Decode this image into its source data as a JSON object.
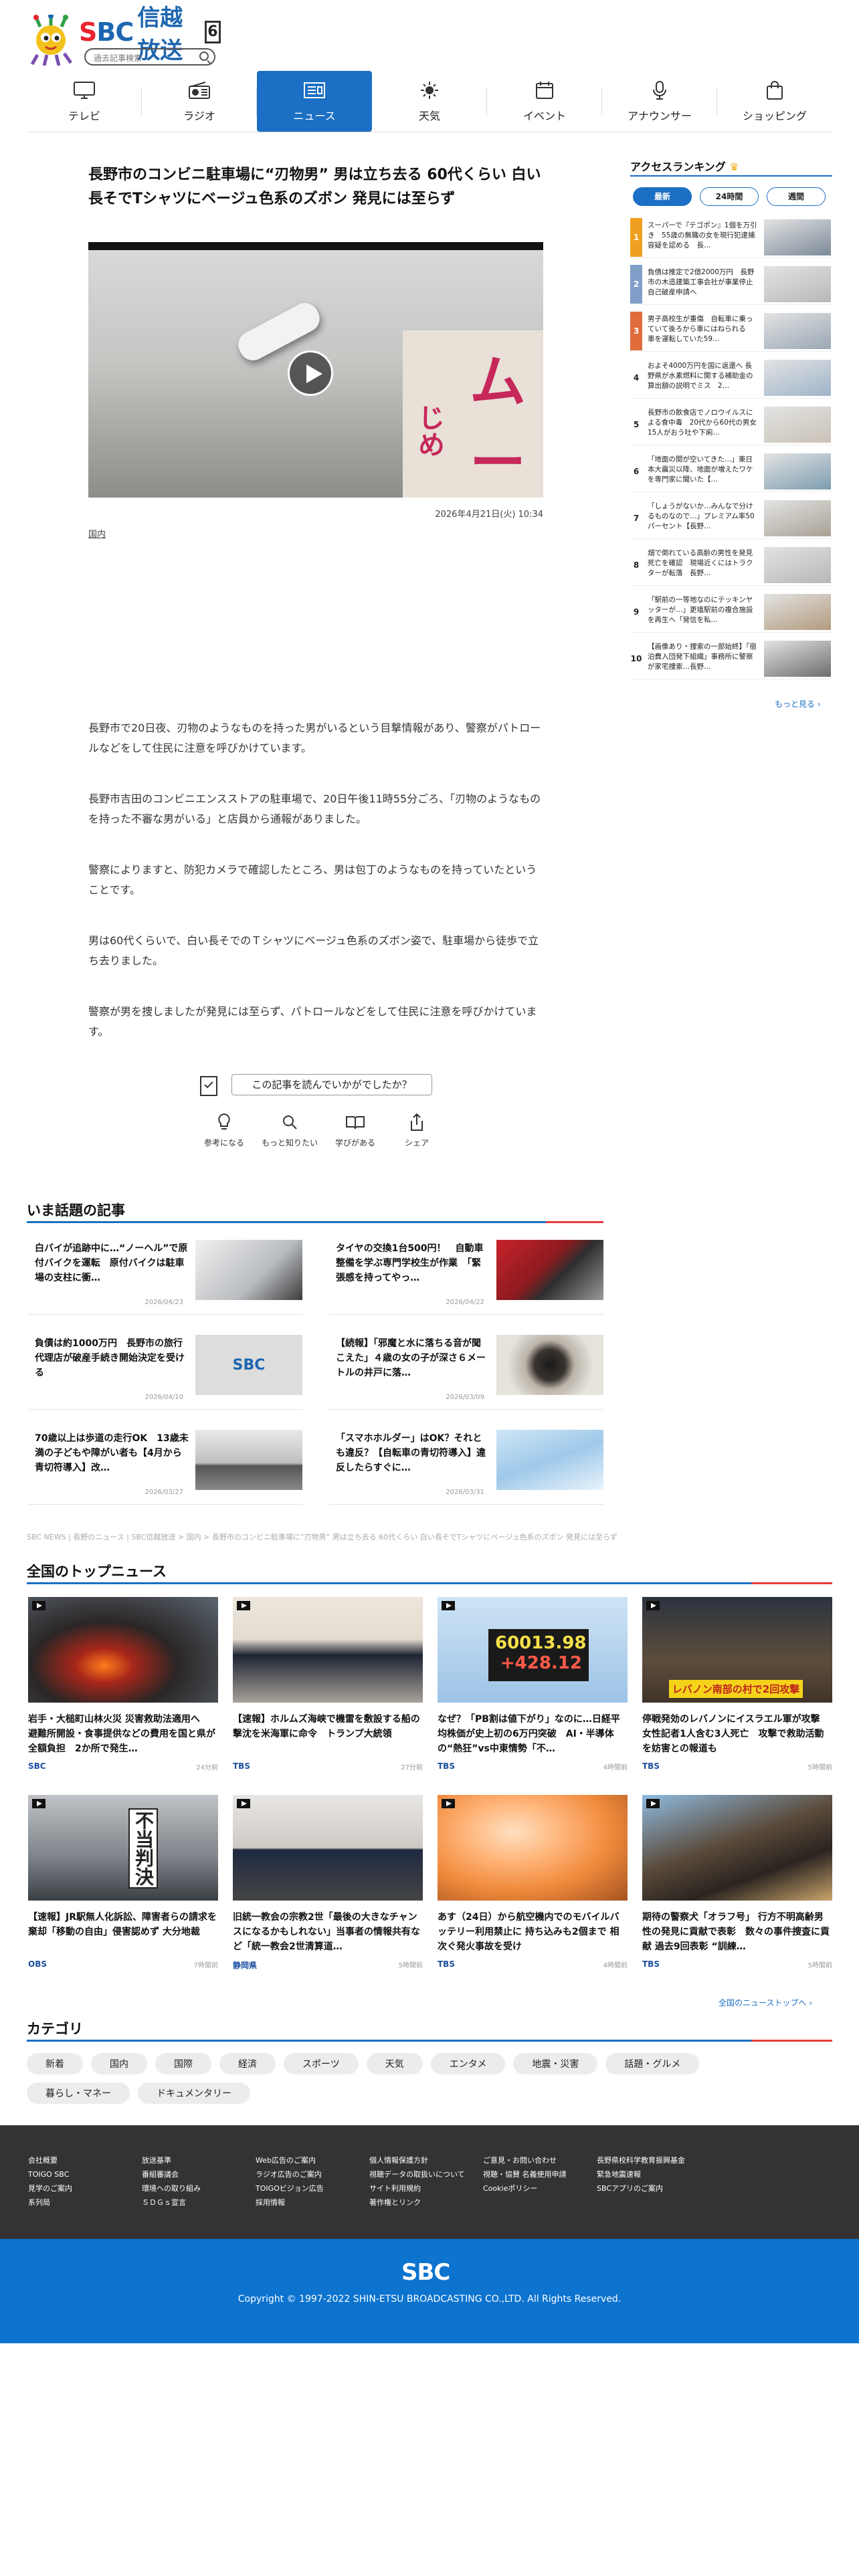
{
  "header": {
    "brand_en": "SBC",
    "brand_jp": "信越放送",
    "channel": "6",
    "search_placeholder": "過去記事検索"
  },
  "nav": [
    {
      "label": "テレビ",
      "icon": "tv-icon"
    },
    {
      "label": "ラジオ",
      "icon": "radio-icon"
    },
    {
      "label": "ニュース",
      "icon": "news-icon",
      "active": true
    },
    {
      "label": "天気",
      "icon": "sun-icon"
    },
    {
      "label": "イベント",
      "icon": "calendar-icon"
    },
    {
      "label": "アナウンサー",
      "icon": "microphone-icon"
    },
    {
      "label": "ショッピング",
      "icon": "shopping-bag-icon"
    }
  ],
  "article": {
    "title": "長野市のコンビニ駐車場に“刃物男” 男は立ち去る 60代くらい 白い長そでTシャツにベージュ色系のズボン 発見には至らず",
    "date": "2026年4月21日(火) 10:34",
    "category": "国内",
    "paragraphs": [
      "長野市で20日夜、刃物のようなものを持った男がいるという目撃情報があり、警察がパトロールなどをして住民に注意を呼びかけています。",
      "長野市吉田のコンビニエンスストアの駐車場で、20日午後11時55分ごろ、「刃物のようなものを持った不審な男がいる」と店員から通報がありました。",
      "警察によりますと、防犯カメラで確認したところ、男は包丁のようなものを持っていたということです。",
      "男は60代くらいで、白い長そでのＴシャツにベージュ色系のズボン姿で、駐車場から徒歩で立ち去りました。",
      "警察が男を捜しましたが発見には至らず、パトロールなどをして住民に注意を呼びかけています。"
    ],
    "video_sign_text": [
      "ムー",
      "じめ"
    ],
    "feedback_question": "この記事を読んでいかがでしたか？",
    "reactions": [
      "参考になる",
      "もっと知りたい",
      "学びがある",
      "シェア"
    ]
  },
  "trending": {
    "heading": "いま話題の記事",
    "items": [
      {
        "title": "白バイが追跡中に…“ノーヘル”で原付バイクを運転　原付バイクは駐車場の支柱に衝…",
        "date": "2026/04/23"
      },
      {
        "title": "タイヤの交換1台500円！　自動車整備を学ぶ専門学校生が作業　「緊張感を持ってやっ…",
        "date": "2026/04/22"
      },
      {
        "title": "負債は約1000万円　長野市の旅行代理店が破産手続き開始決定を受ける",
        "date": "2026/04/10"
      },
      {
        "title": "【続報】「邪魔と水に落ちる音が聞こえた」４歳の女の子が深さ６メートルの井戸に落…",
        "date": "2026/03/09"
      },
      {
        "title": "70歳以上は歩道の走行OK　13歳未満の子どもや障がい者も【4月から青切符導入】改…",
        "date": "2026/03/27"
      },
      {
        "title": "「スマホホルダー」はOK？それとも違反？【自転車の青切符導入】違反したらすぐに…",
        "date": "2026/03/31"
      }
    ]
  },
  "breadcrumb": "SBC NEWS | 長野のニュース | SBC信越放送 > 国内 > 長野市のコンビニ駐車場に“刃物男” 男は立ち去る 60代くらい 白い長そでTシャツにベージュ色系のズボン 発見には至らず",
  "national": {
    "heading": "全国のトップニュース",
    "items": [
      {
        "title": "岩手・大槌町山林火災 災害救助法適用へ　避難所開設・食事提供などの費用を国と県が全額負担　2か所で発生…",
        "source": "SBC",
        "time": "24分前"
      },
      {
        "title": "【速報】ホルムズ海峡で機雷を敷設する船の撃沈を米海軍に命令　トランプ大統領",
        "source": "TBS",
        "time": "27分前"
      },
      {
        "title": "なぜ？「PB割は値下がり」なのに…日経平均株価が史上初の6万円突破　AI・半導体の“熱狂”vs中東情勢「不…",
        "source": "TBS",
        "time": "4時間前"
      },
      {
        "title": "停戦発効のレバノンにイスラエル軍が攻撃 女性記者1人含む3人死亡　攻撃で救助活動を妨害との報道も",
        "source": "TBS",
        "time": "5時間前"
      },
      {
        "title": "【速報】JR駅無人化訴訟、障害者らの請求を棄却「移動の自由」侵害認めず 大分地裁",
        "source": "OBS",
        "time": "7時間前"
      },
      {
        "title": "旧統一教会の宗教2世「最後の大きなチャンスになるかもしれない」当事者の情報共有など「統一教会2世清算道…",
        "source": "静岡県",
        "time": "5時間前"
      },
      {
        "title": "あす（24日）から航空機内でのモバイルバッテリー利用禁止に 持ち込みも2個まで 相次ぐ発火事故を受け",
        "source": "TBS",
        "time": "4時間前"
      },
      {
        "title": "期待の警察犬「オラフ号」 行方不明高齢男性の発見に貢献で表彰　数々の事件捜査に貢献 過去9回表彰 “訓練…",
        "source": "TBS",
        "time": "5時間前"
      }
    ],
    "image_texts": {
      "stock_main": "60013.98",
      "stock_delta": "+428.12",
      "lebanon_caption": "レバノン南部の村で2回攻撃",
      "court_sign": "不当判決"
    },
    "more_label": "全国のニューストップへ ›"
  },
  "categories": {
    "heading": "カテゴリ",
    "items": [
      "新着",
      "国内",
      "国際",
      "経済",
      "スポーツ",
      "天気",
      "エンタメ",
      "地震・災害",
      "話題・グルメ",
      "暮らし・マネー",
      "ドキュメンタリー"
    ]
  },
  "sidebar": {
    "heading": "アクセスランキング",
    "tabs": [
      "最新",
      "24時間",
      "週間"
    ],
    "items": [
      {
        "rank": "1",
        "title": "スーパーで『テゴポン』1個を万引き　55歳の無職の女を現行犯逮捕　容疑を認める　長…"
      },
      {
        "rank": "2",
        "title": "負債は推定で2億2000万円　長野市の木造建築工事会社が事業停止　自己破産申請へ"
      },
      {
        "rank": "3",
        "title": "男子高校生が重傷　自転車に乗っていて後ろから車にはねられる　車を運転していた59…"
      },
      {
        "rank": "4",
        "title": "およそ4000万円を国に返還へ 長野県が水素燃料に関する補助金の算出額の説明でミス　2…"
      },
      {
        "rank": "5",
        "title": "長野市の飲食店でノロウイルスによる食中毒　20代から60代の男女15人がおう吐や下痢…"
      },
      {
        "rank": "6",
        "title": "「地面の間が空いてきた…」東日本大震災以降、地面が増えたワケを専門家に聞いた【…"
      },
      {
        "rank": "7",
        "title": "「しょうがないか…みんなで分けるものなので…」プレミアム率50パーセント【長野…"
      },
      {
        "rank": "8",
        "title": "畑で倒れている高齢の男性を発見　死亡を確認　現場近くにはトラクターが転落　長野…"
      },
      {
        "rank": "9",
        "title": "「駅前の一等地なのにテッキンヤッターが…」更埴駅前の複合施設を再生へ「発信を私…"
      },
      {
        "rank": "10",
        "title": "【画像あり・捜索の一部始終】「宿泊費入団発下組織」事務所に警察が家宅捜索…長野…"
      }
    ],
    "rank_colors": [
      "#f0a020",
      "#7f9fc8",
      "#e06c3c"
    ],
    "more_label": "もっと見る ›"
  },
  "footer": {
    "columns": [
      [
        "会社概要",
        "TOIGO SBC",
        "見学のご案内",
        "系列局"
      ],
      [
        "放送基準",
        "番組審議会",
        "環境への取り組み",
        "ＳＤＧｓ宣言"
      ],
      [
        "Web広告のご案内",
        "ラジオ広告のご案内",
        "TOIGOビジョン広告",
        "採用情報"
      ],
      [
        "個人情報保護方針",
        "視聴データの取扱いについて",
        "サイト利用規約",
        "著作権とリンク"
      ],
      [
        "ご意見・お問い合わせ",
        "視聴・協賛 名義使用申請",
        "Cookieポリシー"
      ],
      [
        "長野県校科学教育振興基金",
        "緊急地震速報",
        "SBCアプリのご案内"
      ]
    ],
    "logo": "SBC",
    "copyright": "Copyright © 1997-2022 SHIN-ETSU BROADCASTING CO.,LTD. All Rights Reserved."
  }
}
